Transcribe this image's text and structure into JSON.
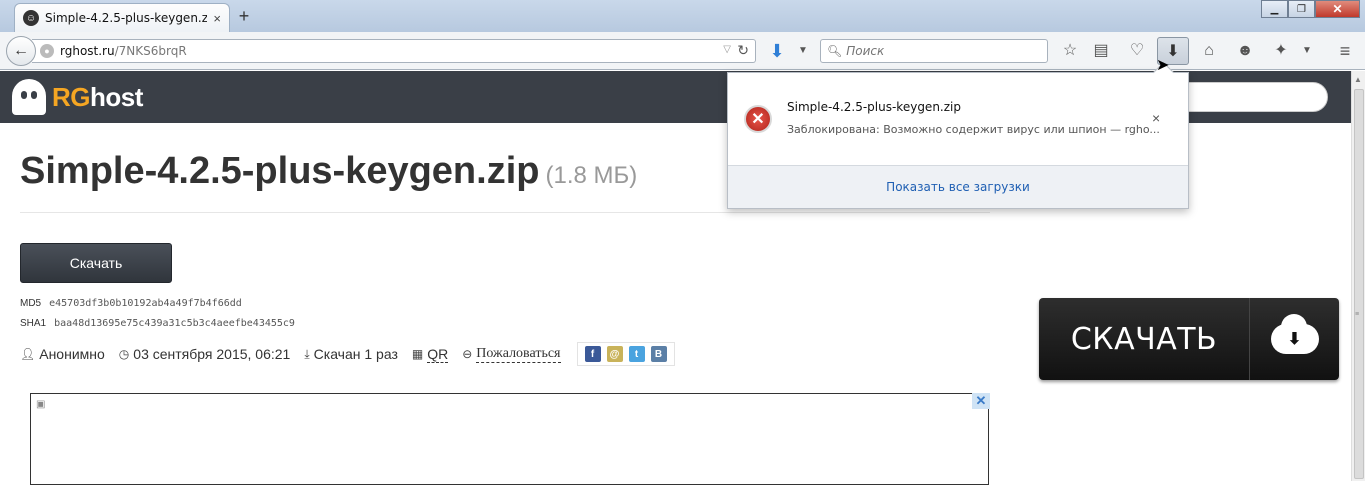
{
  "browser": {
    "tab_title": "Simple-4.2.5-plus-keygen.z...",
    "tab_close": "×",
    "new_tab": "+",
    "url_host": "rghost.ru",
    "url_path": "/7NKS6brqR",
    "search_placeholder": "Поиск",
    "window": {
      "minimize": "▁",
      "maximize": "❐",
      "close": "✕"
    }
  },
  "site": {
    "logo_rg": "RG",
    "logo_host": "host"
  },
  "file": {
    "name": "Simple-4.2.5-plus-keygen.zip",
    "size": "(1.8 МБ)",
    "download_label": "Скачать",
    "md5_label": "MD5",
    "md5": "e45703df3b0b10192ab4a49f7b4f66dd",
    "sha1_label": "SHA1",
    "sha1": "baa48d13695e75c439a31c5b3c4aeefbe43455c9",
    "author": "Анонимно",
    "date": "03 сентября 2015, 06:21",
    "downloads": "Скачан 1 раз",
    "qr": "QR",
    "report": "Пожаловаться"
  },
  "big_button": {
    "label": "СКАЧАТЬ"
  },
  "download_panel": {
    "filename": "Simple-4.2.5-plus-keygen.zip",
    "status": "Заблокирована: Возможно содержит вирус или шпион — rgho...",
    "show_all": "Показать все загрузки",
    "remove": "×"
  },
  "ad": {
    "close": "✕"
  },
  "colors": {
    "header_bg": "#3a3f47",
    "logo_accent": "#f5a623",
    "error_red": "#c0392b",
    "link_blue": "#1f5fb3"
  }
}
